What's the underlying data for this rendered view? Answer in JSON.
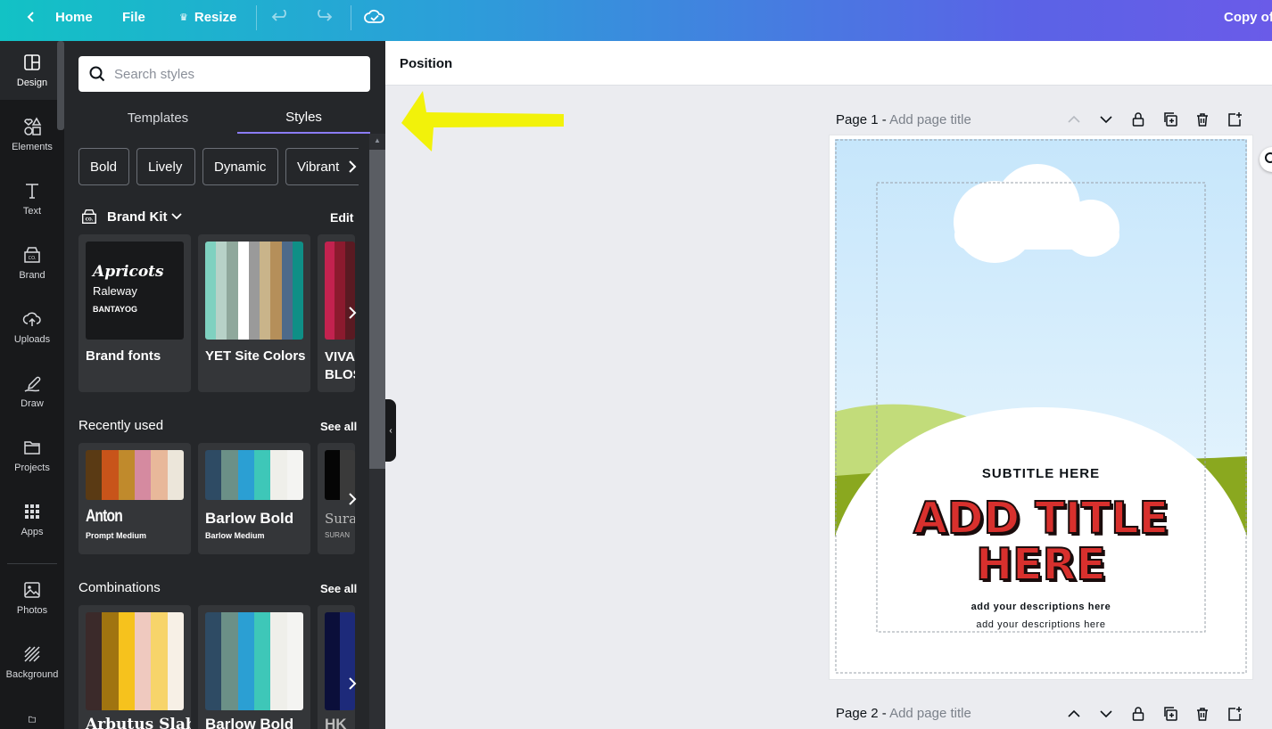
{
  "topbar": {
    "home": "Home",
    "file": "File",
    "resize": "Resize",
    "doc_title": "Copy of"
  },
  "rail": {
    "items": [
      {
        "label": "Design",
        "icon": "design-icon"
      },
      {
        "label": "Elements",
        "icon": "elements-icon"
      },
      {
        "label": "Text",
        "icon": "text-icon"
      },
      {
        "label": "Brand",
        "icon": "brand-icon"
      },
      {
        "label": "Uploads",
        "icon": "uploads-icon"
      },
      {
        "label": "Draw",
        "icon": "draw-icon"
      },
      {
        "label": "Projects",
        "icon": "projects-icon"
      },
      {
        "label": "Apps",
        "icon": "apps-icon"
      },
      {
        "label": "Photos",
        "icon": "photos-icon"
      },
      {
        "label": "Background",
        "icon": "background-icon"
      }
    ]
  },
  "panel": {
    "search_placeholder": "Search styles",
    "tabs": [
      "Templates",
      "Styles"
    ],
    "active_tab": "Styles",
    "chips": [
      "Bold",
      "Lively",
      "Dynamic",
      "Vibrant"
    ],
    "brand_kit": {
      "title": "Brand Kit",
      "edit": "Edit",
      "brand_fonts": {
        "label": "Brand fonts",
        "font1": "Apricots",
        "font2": "Raleway",
        "font3": "BANTAYOG"
      },
      "site_colors": {
        "label": "YET Site Colors",
        "colors": [
          "#7fd1c0",
          "#b7d2c8",
          "#8fa89c",
          "#ffffff",
          "#9a9a9a",
          "#c9b48a",
          "#b58f5a",
          "#4d6a8a",
          "#0f8f86"
        ]
      },
      "third": {
        "label_line1": "VIVA",
        "label_line2": "BLOS",
        "colors": [
          "#c2224f",
          "#8b1a2e",
          "#5a1a22"
        ]
      }
    },
    "recently_used": {
      "title": "Recently used",
      "see_all": "See all",
      "cards": [
        {
          "title": "Anton",
          "subtitle": "Prompt Medium",
          "colors": [
            "#5a3a14",
            "#c8541a",
            "#c08a2c",
            "#d58aa0",
            "#e8b89a",
            "#ece6da"
          ]
        },
        {
          "title": "Barlow Bold",
          "subtitle": "Barlow Medium",
          "colors": [
            "#2e4b64",
            "#6b9087",
            "#2b9fd3",
            "#3ec7b8",
            "#efefea",
            "#f4f4f2"
          ]
        },
        {
          "title": "Sura",
          "subtitle": "SURAN",
          "colors": [
            "#050505",
            "#3a3a3a"
          ]
        }
      ]
    },
    "combinations": {
      "title": "Combinations",
      "see_all": "See all",
      "cards": [
        {
          "title": "Arbutus Slab",
          "colors": [
            "#3b2a2a",
            "#a07410",
            "#f6c21d",
            "#efc9bf",
            "#f7d46a",
            "#f7f0e6"
          ]
        },
        {
          "title": "Barlow Bold",
          "colors": [
            "#2e4b64",
            "#6b9087",
            "#2b9fd3",
            "#3ec7b8",
            "#efefea",
            "#f4f4f2"
          ]
        },
        {
          "title": "HK",
          "colors": [
            "#0b0f3a",
            "#1d2a7a"
          ]
        }
      ]
    }
  },
  "toolbar": {
    "position": "Position"
  },
  "pages": [
    {
      "label": "Page 1 -",
      "placeholder": "Add page title"
    },
    {
      "label": "Page 2 -",
      "placeholder": "Add page title"
    }
  ],
  "poster": {
    "subtitle": "SUBTITLE HERE",
    "title_line1": "ADD TITLE",
    "title_line2": "HERE",
    "desc_bold": "add your descriptions here",
    "desc": "add your descriptions here"
  },
  "colors": {
    "accent_tab": "#8b7cf6",
    "highlight_arrow": "#f2f20a",
    "title_red": "#d8302d"
  }
}
